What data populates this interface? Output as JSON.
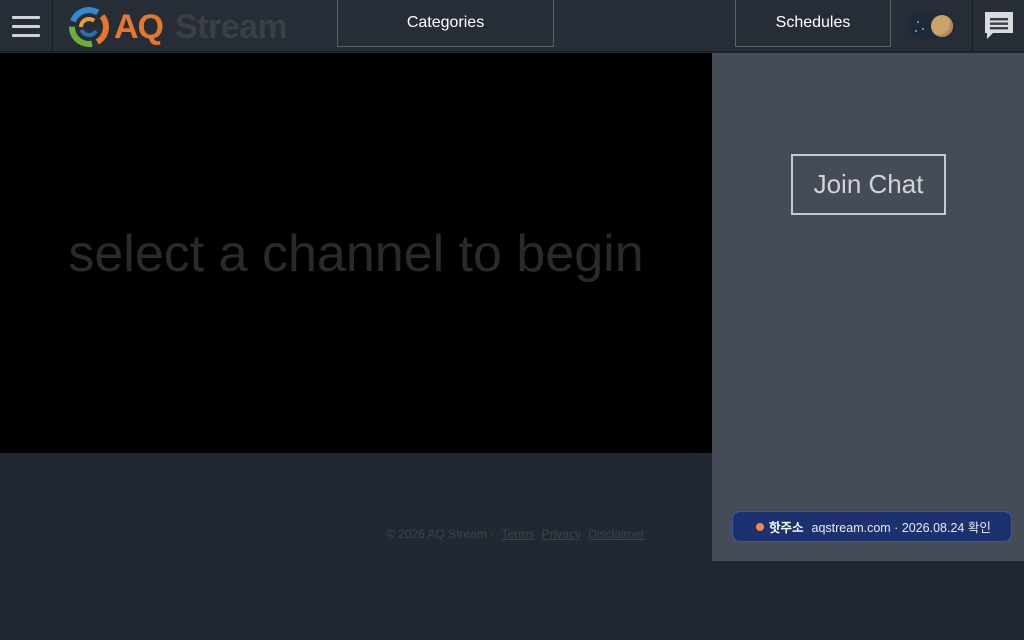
{
  "header": {
    "logo_primary": "AQ",
    "logo_secondary": "Stream",
    "nav": {
      "categories_label": "Categories",
      "schedules_label": "Schedules"
    }
  },
  "player": {
    "message": "select a channel to begin"
  },
  "chat": {
    "join_label": "Join Chat"
  },
  "footer": {
    "copyright": "© 2026 AQ Stream ·",
    "terms": "Terms",
    "privacy": "Privacy",
    "disclaimer": "Disclaimer"
  },
  "notice": {
    "label": "핫주소",
    "text": "aqstream.com · 2026.08.24 확인"
  },
  "colors": {
    "accent": "#e8762b",
    "header_bg": "#272d36",
    "page_bg": "#222831",
    "chat_panel_bg": "#454c57",
    "notice_bg": "#1c3170"
  },
  "icons": {
    "menu": "hamburger-icon",
    "logo": "swirl-logo-icon",
    "theme": "moon-toggle-icon",
    "chat": "chat-bubble-icon"
  }
}
